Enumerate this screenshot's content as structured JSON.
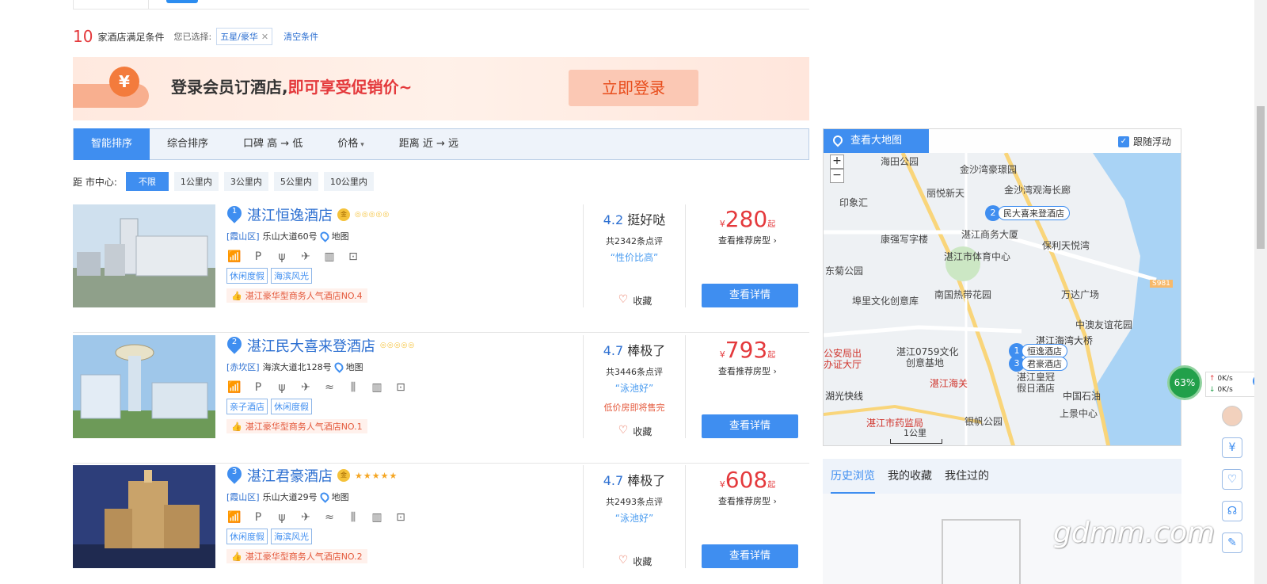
{
  "filter": {
    "count": "10",
    "count_text": "家酒店满足条件",
    "chosen_label": "您已选择:",
    "chosen_tag": "五星/豪华",
    "clear_label": "清空条件"
  },
  "banner": {
    "text_main": "登录会员订酒店,",
    "text_promo": "即可享受促销价~",
    "button_label": "立即登录",
    "coin_symbol": "¥"
  },
  "sort": {
    "options": [
      "智能排序",
      "综合排序",
      "口碑 高 → 低",
      "价格",
      "距离 近 → 远"
    ],
    "active_index": 0
  },
  "distance": {
    "label": "距 市中心:",
    "options": [
      "不限",
      "1公里内",
      "3公里内",
      "5公里内",
      "10公里内"
    ],
    "active_index": 0
  },
  "hotels": [
    {
      "rank": "1",
      "name": "湛江恒逸酒店",
      "medal": "金",
      "stars": "◎◎◎◎◎",
      "district": "[霞山区]",
      "address": "乐山大道60号",
      "map_label": "地图",
      "facilities": [
        "wifi",
        "P",
        "restaurant",
        "airport",
        "building",
        "luggage"
      ],
      "tags": [
        "休闲度假",
        "海滨风光"
      ],
      "rank_text": "湛江豪华型商务人气酒店NO.4",
      "score": "4.2",
      "score_word": "挺好哒",
      "reviews": "共2342条点评",
      "comment": "“性价比高”",
      "low_price": "",
      "fav_label": "收藏",
      "currency": "¥",
      "price": "280",
      "price_suffix": "起",
      "recommend": "查看推荐房型 ›",
      "detail_label": "查看详情"
    },
    {
      "rank": "2",
      "name": "湛江民大喜来登酒店",
      "medal": "",
      "stars": "◎◎◎◎◎",
      "district": "[赤坎区]",
      "address": "海滨大道北128号",
      "map_label": "地图",
      "facilities": [
        "wifi",
        "P",
        "restaurant",
        "airport",
        "pool",
        "gym",
        "building",
        "luggage"
      ],
      "tags": [
        "亲子酒店",
        "休闲度假"
      ],
      "rank_text": "湛江豪华型商务人气酒店NO.1",
      "score": "4.7",
      "score_word": "棒极了",
      "reviews": "共3446条点评",
      "comment": "“泳池好”",
      "low_price": "低价房即将售完",
      "fav_label": "收藏",
      "currency": "¥",
      "price": "793",
      "price_suffix": "起",
      "recommend": "查看推荐房型 ›",
      "detail_label": "查看详情"
    },
    {
      "rank": "3",
      "name": "湛江君豪酒店",
      "medal": "金",
      "stars": "★★★★★",
      "district": "[霞山区]",
      "address": "乐山大道29号",
      "map_label": "地图",
      "facilities": [
        "wifi",
        "P",
        "restaurant",
        "airport",
        "pool",
        "gym",
        "building",
        "luggage"
      ],
      "tags": [
        "休闲度假",
        "海滨风光"
      ],
      "rank_text": "湛江豪华型商务人气酒店NO.2",
      "score": "4.7",
      "score_word": "棒极了",
      "reviews": "共2493条点评",
      "comment": "“泳池好”",
      "low_price": "",
      "fav_label": "收藏",
      "currency": "¥",
      "price": "608",
      "price_suffix": "起",
      "recommend": "查看推荐房型 ›",
      "detail_label": "查看详情"
    }
  ],
  "map": {
    "big_map_label": "查看大地图",
    "follow_label": "跟随浮动",
    "follow_checked": true,
    "scale_label": "1公里",
    "labels": [
      "海田公园",
      "金沙湾豪璟园",
      "丽悦新天",
      "金沙湾观海长廊",
      "印象汇",
      "康强写字楼",
      "湛江商务大厦",
      "保利天悦湾",
      "湛江市体育中心",
      "东菊公园",
      "南国热带花园",
      "万达广场",
      "埠里文化创意库",
      "中澳友谊花园",
      "湛江海湾大桥",
      "湛江0759文化",
      "创意基地",
      "公安局出",
      "办证大厅",
      "湛江海关",
      "湛江皇冠",
      "假日酒店",
      "中国石油",
      "湖光快线",
      "上景中心",
      "湛江市药监局",
      "银帆公园",
      "S981"
    ],
    "pins": [
      {
        "n": "2",
        "label": "民大喜来登酒店"
      },
      {
        "n": "1",
        "label": "恒逸酒店"
      },
      {
        "n": "3",
        "label": "君豪酒店"
      }
    ]
  },
  "history": {
    "tabs": [
      "历史浏览",
      "我的收藏",
      "我住过的"
    ],
    "active_index": 0
  },
  "netmon": {
    "percent": "63%",
    "up": "0K/s",
    "down": "0K/s"
  },
  "watermark": "gdmm.com"
}
